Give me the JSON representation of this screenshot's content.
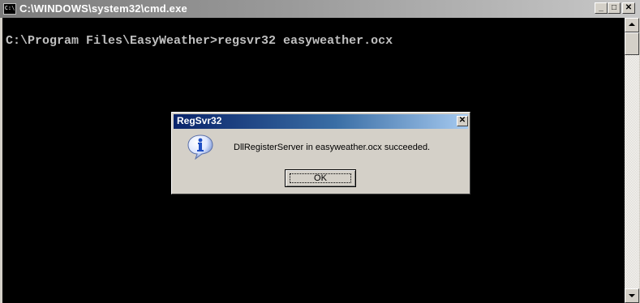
{
  "window": {
    "title": "C:\\WINDOWS\\system32\\cmd.exe",
    "icon_label": "C:\\",
    "controls": {
      "minimize": "_",
      "maximize": "□",
      "close": "✕"
    }
  },
  "console": {
    "lines": [
      "C:\\Program Files\\EasyWeather>regsvr32 easyweather.ocx"
    ]
  },
  "dialog": {
    "title": "RegSvr32",
    "close_label": "✕",
    "icon": "info-icon",
    "message": "DllRegisterServer in easyweather.ocx succeeded.",
    "ok_label": "OK"
  },
  "colors": {
    "console_bg": "#000000",
    "console_text": "#c0c0c0",
    "dialog_title_start": "#0a246a",
    "dialog_title_end": "#a6caf0",
    "inactive_title_start": "#7b7b7b",
    "window_face": "#d4d0c8"
  }
}
